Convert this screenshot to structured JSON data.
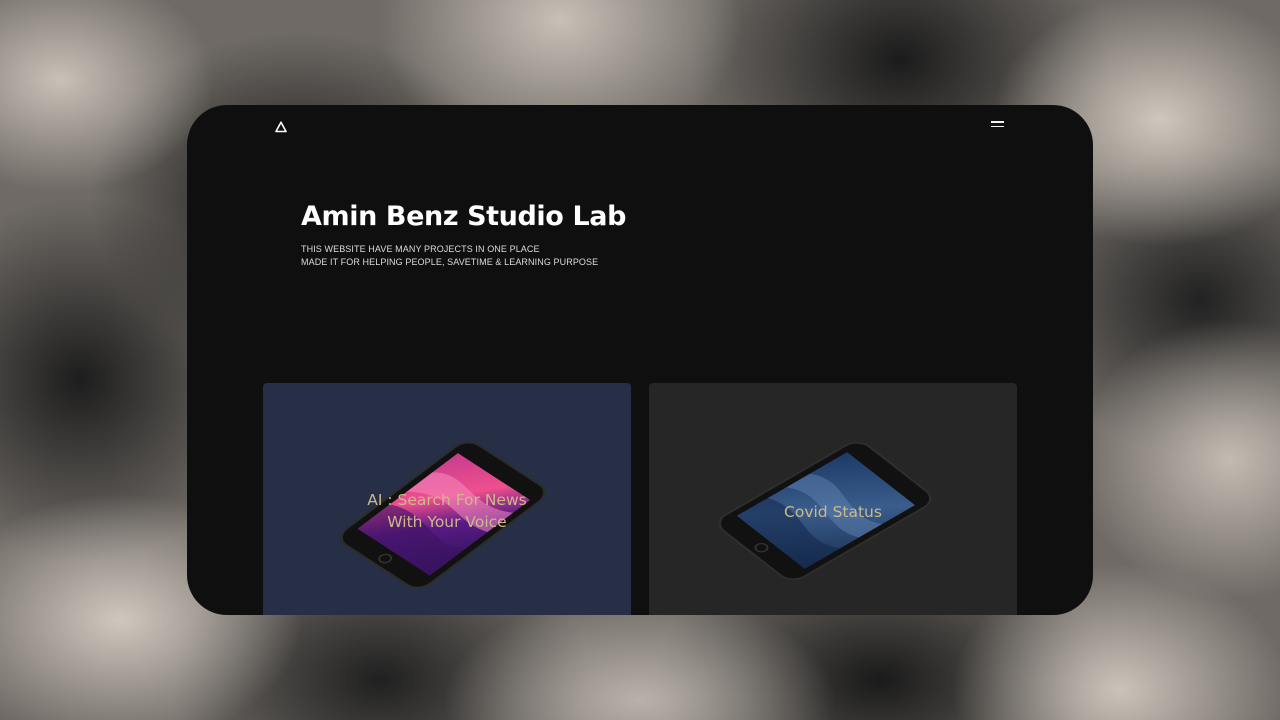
{
  "hero": {
    "title": "Amin Benz Studio Lab",
    "subtitle_line1": "THIS WEBSITE HAVE MANY PROJECTS IN ONE PLACE",
    "subtitle_line2": "MADE IT FOR HELPING PEOPLE, SAVETIME & LEARNING PURPOSE"
  },
  "header": {
    "logo_icon": "triangle-logo-icon",
    "menu_icon": "hamburger-menu-icon"
  },
  "projects": [
    {
      "title_line1": "AI : Search For News",
      "title_line2": "With Your Voice",
      "icon": "phone-mockup",
      "card_color": "#262f46"
    },
    {
      "title_line1": "Covid Status",
      "icon": "phone-mockup",
      "card_color": "#262626"
    }
  ],
  "colors": {
    "window_bg": "#0f0f0f",
    "title_text": "#ffffff",
    "card_label": "#ccb98c"
  }
}
